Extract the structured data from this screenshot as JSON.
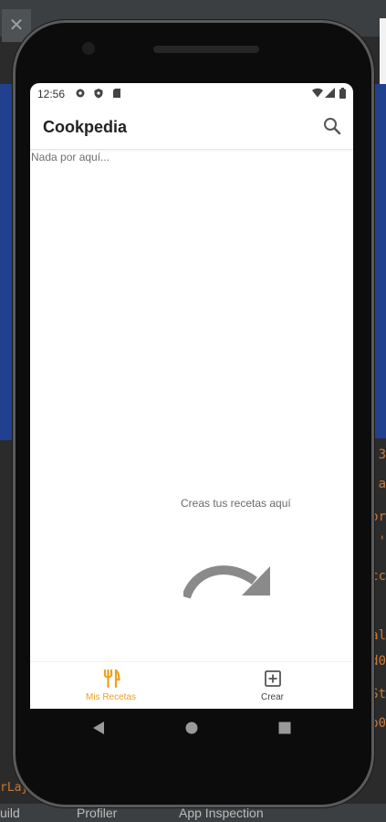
{
  "ide": {
    "close_glyph": "✕",
    "bottom_items": [
      "uild",
      "Profiler",
      "App Inspection"
    ],
    "left_code": "rLay",
    "right_code": [
      "3",
      "a",
      "or",
      "'",
      "cc",
      "al",
      "d0",
      "St",
      "p0"
    ]
  },
  "status_bar": {
    "time": "12:56",
    "icons": [
      "settings-icon",
      "shield-icon",
      "sd-card-icon"
    ],
    "right_icons": [
      "wifi-icon",
      "signal-icon",
      "battery-icon"
    ]
  },
  "app_bar": {
    "title": "Cookpedia",
    "search_icon": "search-icon"
  },
  "main": {
    "empty_text": "Nada por aquí...",
    "hint_text": "Creas tus recetas aquí"
  },
  "bottom_nav": {
    "items": [
      {
        "label": "Mis Recetas",
        "icon": "restaurant-icon",
        "active": true
      },
      {
        "label": "Crear",
        "icon": "add-box-icon",
        "active": false
      }
    ]
  },
  "colors": {
    "accent": "#f0a020",
    "arrow": "#8a8a8a"
  }
}
